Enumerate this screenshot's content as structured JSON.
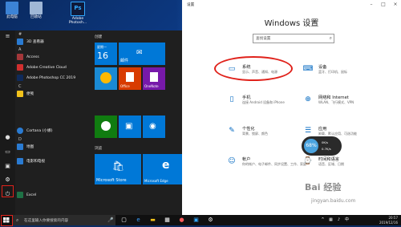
{
  "desktop": {
    "icons": [
      {
        "label": "此电脑",
        "color": "#3c83d6"
      },
      {
        "label": "回收站",
        "color": "#9fb7d6"
      },
      {
        "label": "Adobe Photosh...",
        "color": "#0f1a3a"
      }
    ]
  },
  "start_menu": {
    "letters": [
      "#",
      "A",
      "C",
      "D"
    ],
    "apps": [
      {
        "label": "3D 查看器",
        "color": "#2a7bd2"
      },
      {
        "label": "Access",
        "color": "#a4373a"
      },
      {
        "label": "Adobe Creative Cloud",
        "color": "#d12f2f"
      },
      {
        "label": "Adobe Photoshop CC 2019",
        "color": "#0f2a5a"
      },
      {
        "label": "便笺",
        "color": "#f2c21b"
      },
      {
        "label": "Cortana (小娜)",
        "color": "#2a7bd2"
      },
      {
        "label": "地图",
        "color": "#2a7bd2"
      },
      {
        "label": "电影和电视",
        "color": "#2a7bd2"
      },
      {
        "label": "Excel",
        "color": "#1e7145"
      }
    ],
    "group_labels": [
      "创建",
      "浏览"
    ],
    "tiles": {
      "calendar_day": "星期一",
      "calendar_date": "16",
      "mail": "邮件",
      "office": "Office",
      "onenote": "OneNote",
      "store": "Microsoft Store",
      "edge": "Microsoft Edge"
    }
  },
  "settings": {
    "window_title": "设置",
    "heading": "Windows 设置",
    "search_placeholder": "查找设置",
    "categories": [
      {
        "name": "系统",
        "desc": "显示、声音、通知、电源",
        "icon": "laptop-icon"
      },
      {
        "name": "设备",
        "desc": "蓝牙、打印机、鼠标",
        "icon": "keyboard-icon"
      },
      {
        "name": "手机",
        "desc": "连接 Android 设备和 iPhone",
        "icon": "phone-icon"
      },
      {
        "name": "网络和 Internet",
        "desc": "WLAN、飞行模式、VPN",
        "icon": "globe-icon"
      },
      {
        "name": "个性化",
        "desc": "背景、锁屏、颜色",
        "icon": "brush-icon"
      },
      {
        "name": "应用",
        "desc": "卸载、默认应用、可选功能",
        "icon": "apps-icon"
      },
      {
        "name": "帐户",
        "desc": "你的帐户、电子邮件、同步设置、工作、家庭",
        "icon": "person-icon"
      },
      {
        "name": "时间和语言",
        "desc": "语音、区域、日期",
        "icon": "time-language-icon"
      }
    ],
    "net_widget": {
      "percent": "68%",
      "up": "0K/s",
      "down": "0.7K/s"
    }
  },
  "taskbar": {
    "search_placeholder": "在这里输入你要搜索的内容",
    "time": "20:57",
    "date": "2019/12/16"
  },
  "watermark": {
    "brand": "Bai 经验",
    "url": "jingyan.baidu.com"
  },
  "colors": {
    "accent": "#0067c0",
    "highlight": "#e0221b",
    "tile_blue": "#0078d7"
  }
}
